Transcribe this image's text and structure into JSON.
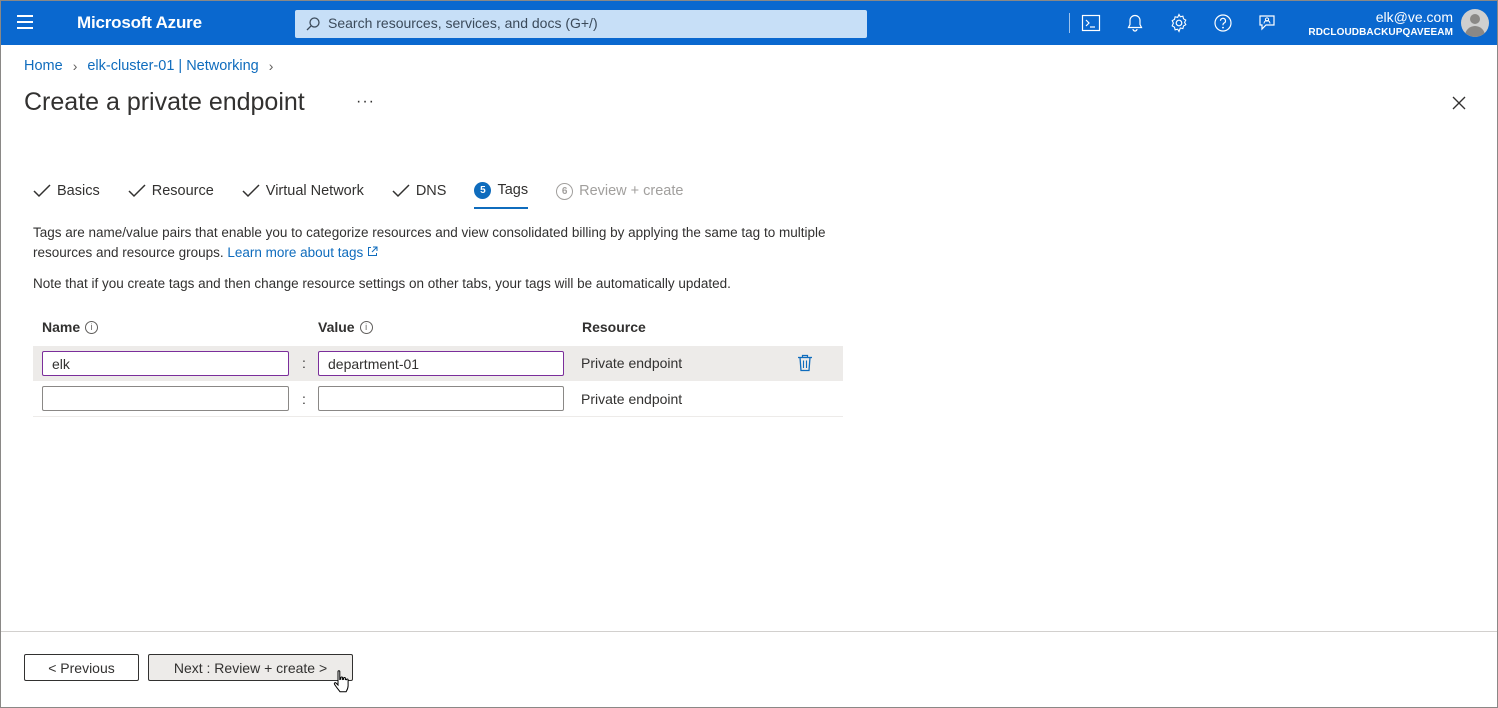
{
  "topbar": {
    "brand": "Microsoft Azure",
    "search_placeholder": "Search resources, services, and docs (G+/)",
    "user_email": "elk@ve.com",
    "user_tenant": "RDCLOUDBACKUPQAVEEAM",
    "icons": [
      "cloud-shell-icon",
      "bell-icon",
      "gear-icon",
      "help-icon",
      "feedback-icon"
    ]
  },
  "breadcrumb": {
    "items": [
      "Home",
      "elk-cluster-01 | Networking"
    ]
  },
  "page": {
    "title": "Create a private endpoint",
    "more": "···"
  },
  "tabs": [
    {
      "label": "Basics",
      "state": "done"
    },
    {
      "label": "Resource",
      "state": "done"
    },
    {
      "label": "Virtual Network",
      "state": "done"
    },
    {
      "label": "DNS",
      "state": "done"
    },
    {
      "label": "Tags",
      "state": "active",
      "num": "5"
    },
    {
      "label": "Review + create",
      "state": "disabled",
      "num": "6"
    }
  ],
  "content": {
    "desc": "Tags are name/value pairs that enable you to categorize resources and view consolidated billing by applying the same tag to multiple resources and resource groups.",
    "learn_more": "Learn more about tags",
    "note": "Note that if you create tags and then change resource settings on other tabs, your tags will be automatically updated."
  },
  "table": {
    "headers": {
      "name": "Name",
      "value": "Value",
      "resource": "Resource"
    },
    "rows": [
      {
        "name": "elk",
        "value": "department-01",
        "resource": "Private endpoint"
      },
      {
        "name": "",
        "value": "",
        "resource": "Private endpoint"
      }
    ],
    "separator": ":"
  },
  "footer": {
    "previous": "< Previous",
    "next": "Next : Review + create >"
  },
  "colors": {
    "topbar": "#0a68cf",
    "accent": "#0f6cbd"
  }
}
